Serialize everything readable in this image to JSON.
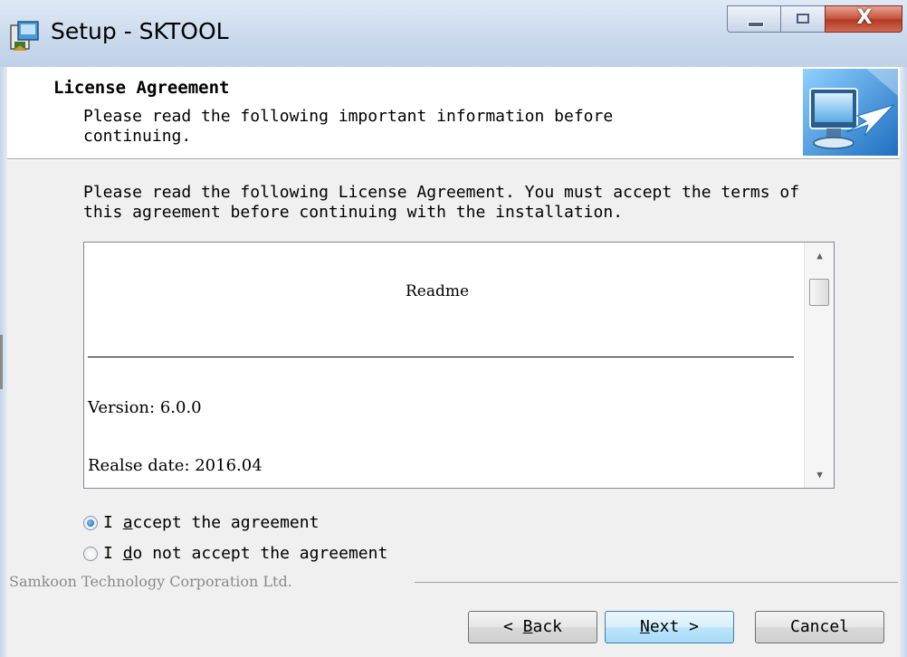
{
  "window": {
    "title": "Setup - SKTOOL",
    "close_glyph": "X"
  },
  "header": {
    "title": "License Agreement",
    "subtitle": "Please read the following important information before continuing."
  },
  "instructions": "Please read the following License Agreement. You must accept the terms of this agreement before continuing with the installation.",
  "license_text": {
    "heading": "Readme",
    "version": "Version: 6.0.0",
    "release_date": "Realse date: 2016.04"
  },
  "radios": {
    "accept": {
      "prefix": "I ",
      "accel": "a",
      "rest": "ccept the agreement",
      "selected": true
    },
    "decline": {
      "prefix": "I ",
      "accel": "d",
      "rest": "o not accept the agreement",
      "selected": false
    }
  },
  "footer": {
    "company": "Samkoon Technology Corporation Ltd."
  },
  "buttons": {
    "back": {
      "pre": "< ",
      "accel": "B",
      "rest": "ack"
    },
    "next": {
      "accel": "N",
      "rest": "ext >"
    },
    "cancel": "Cancel"
  },
  "icons": {
    "app": "setup-app-icon",
    "wizard": "monitor-arrow-wizard-image",
    "scroll_up": "scroll-up-arrow-icon",
    "scroll_down": "scroll-down-arrow-icon"
  },
  "colors": {
    "titlebar": "#c9d9ec",
    "close_button": "#c75a45",
    "default_button": "#bee6fd",
    "radio_selected": "#1b5fb3"
  }
}
